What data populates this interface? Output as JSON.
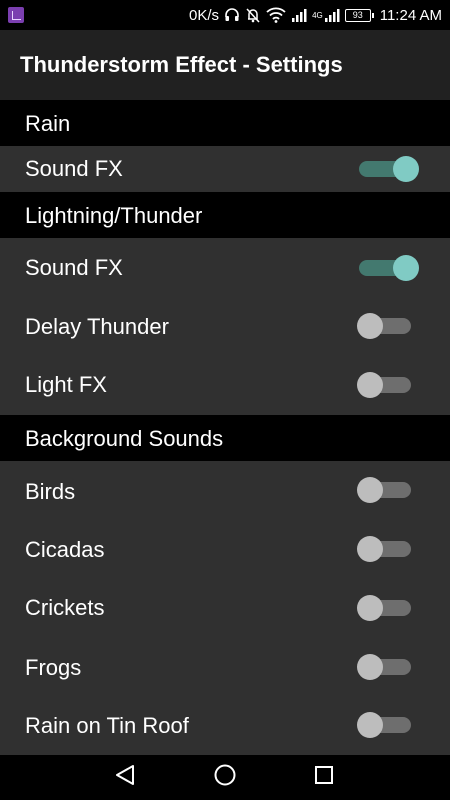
{
  "status_bar": {
    "net_speed": "0K/s",
    "network_type": "4G",
    "battery_level": "93",
    "time": "11:24 AM"
  },
  "app_bar": {
    "title": "Thunderstorm Effect - Settings"
  },
  "sections": [
    {
      "header": "Rain",
      "items": [
        {
          "label": "Sound FX",
          "enabled": true
        }
      ]
    },
    {
      "header": "Lightning/Thunder",
      "items": [
        {
          "label": "Sound FX",
          "enabled": true
        },
        {
          "label": "Delay Thunder",
          "enabled": false
        },
        {
          "label": "Light FX",
          "enabled": false
        }
      ]
    },
    {
      "header": "Background Sounds",
      "items": [
        {
          "label": "Birds",
          "enabled": false
        },
        {
          "label": "Cicadas",
          "enabled": false
        },
        {
          "label": "Crickets",
          "enabled": false
        },
        {
          "label": "Frogs",
          "enabled": false
        },
        {
          "label": "Rain on Tin Roof",
          "enabled": false
        }
      ]
    }
  ],
  "colors": {
    "switch_on_thumb": "#80cbc4",
    "switch_on_track": "#43796f",
    "switch_off_thumb": "#bdbdbd",
    "switch_off_track": "#6e6e6e",
    "list_background": "#303030",
    "app_bar_background": "#212121",
    "header_background": "#000000"
  },
  "icons": {
    "status_bar": [
      "app-notification-icon",
      "headphones-icon",
      "mute-icon",
      "wifi-icon",
      "signal-icon",
      "battery-icon"
    ],
    "nav_bar": [
      "back-icon",
      "home-icon",
      "recents-icon"
    ]
  }
}
